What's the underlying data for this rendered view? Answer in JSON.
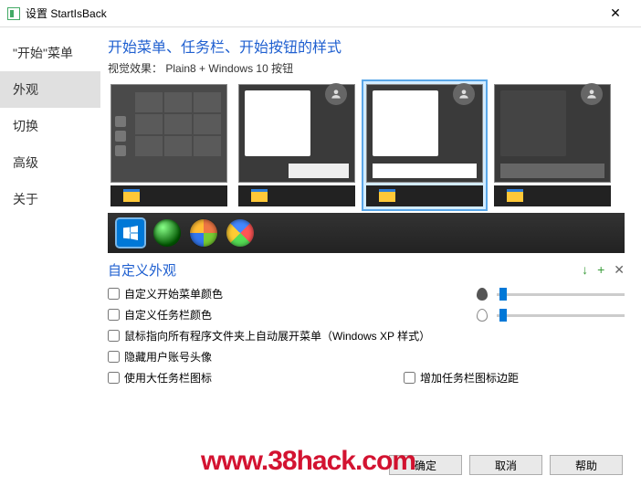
{
  "window": {
    "title": "设置 StartIsBack"
  },
  "sidebar": {
    "items": [
      {
        "label": "\"开始\"菜单"
      },
      {
        "label": "外观"
      },
      {
        "label": "切换"
      },
      {
        "label": "高级"
      },
      {
        "label": "关于"
      }
    ],
    "active_index": 1
  },
  "main": {
    "heading": "开始菜单、任务栏、开始按钮的样式",
    "visual_label": "视觉效果：",
    "visual_value": "Plain8 + Windows 10 按钮",
    "themes": [
      "tiles-dark",
      "plain8-light",
      "plain8-light-selected",
      "plain8-dark"
    ],
    "selected_theme_index": 2,
    "orbs": [
      "windows10",
      "clover",
      "win7-classic",
      "win7-color"
    ],
    "selected_orb_index": 0
  },
  "custom": {
    "title": "自定义外观",
    "actions": {
      "download": "↓",
      "add": "+",
      "close": "✕"
    },
    "options": [
      {
        "label": "自定义开始菜单颜色",
        "has_color": true,
        "color_filled": true,
        "slider": 5
      },
      {
        "label": "自定义任务栏颜色",
        "has_color": true,
        "color_filled": false,
        "slider": 5
      },
      {
        "label": "鼠标指向所有程序文件夹上自动展开菜单（Windows XP 样式）"
      },
      {
        "label": "隐藏用户账号头像"
      },
      {
        "label": "使用大任务栏图标",
        "right_label": "增加任务栏图标边距"
      }
    ]
  },
  "buttons": {
    "ok": "确定",
    "cancel": "取消",
    "help": "帮助"
  },
  "watermark": "www.38hack.com"
}
